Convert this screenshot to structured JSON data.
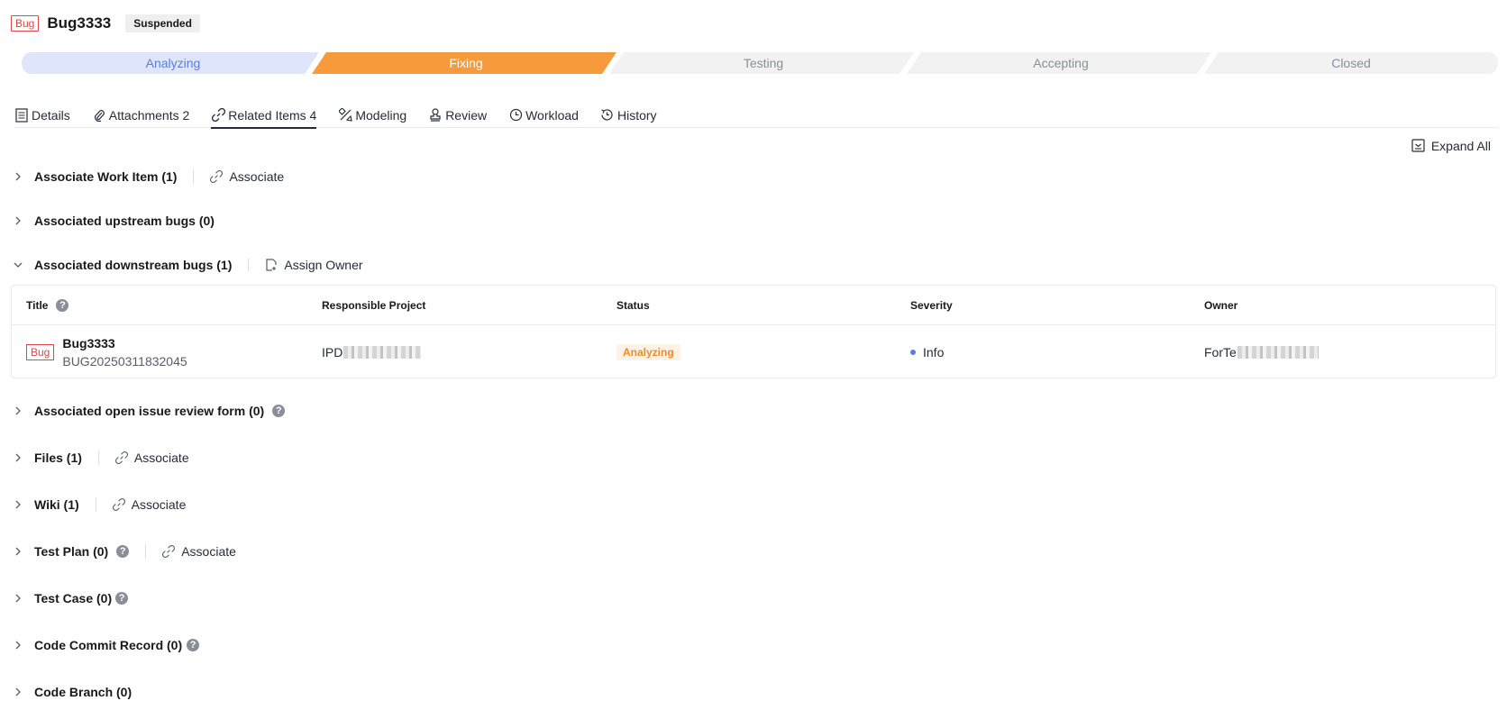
{
  "header": {
    "type_tag": "Bug",
    "title": "Bug3333",
    "state": "Suspended"
  },
  "stepper": {
    "steps": [
      "Analyzing",
      "Fixing",
      "Testing",
      "Accepting",
      "Closed"
    ],
    "current": "Fixing",
    "colors": {
      "done": "#dfe6fb",
      "done_text": "#5e7ce0",
      "current": "#f69a3c",
      "current_text": "#ffffff",
      "todo": "#f2f2f2",
      "todo_text": "#8a8e99"
    }
  },
  "tabs": [
    {
      "label": "Details",
      "icon": "document-list-icon"
    },
    {
      "label": "Attachments 2",
      "icon": "paperclip-icon"
    },
    {
      "label": "Related Items 4",
      "icon": "link-icon",
      "active": true
    },
    {
      "label": "Modeling",
      "icon": "modeling-icon"
    },
    {
      "label": "Review",
      "icon": "stamp-icon"
    },
    {
      "label": "Workload",
      "icon": "clock-icon"
    },
    {
      "label": "History",
      "icon": "history-icon"
    }
  ],
  "expand_all_label": "Expand All",
  "sections": {
    "work_item": {
      "title": "Associate Work Item (1)",
      "action": "Associate"
    },
    "upstream": {
      "title": "Associated upstream bugs (0)"
    },
    "downstream": {
      "title": "Associated downstream bugs (1)",
      "action": "Assign Owner"
    },
    "review_form": {
      "title": "Associated open issue review form (0)"
    },
    "files": {
      "title": "Files (1)",
      "action": "Associate"
    },
    "wiki": {
      "title": "Wiki (1)",
      "action": "Associate"
    },
    "test_plan": {
      "title": "Test Plan (0)",
      "action": "Associate"
    },
    "test_case": {
      "title": "Test Case (0)"
    },
    "commit": {
      "title": "Code Commit Record (0)"
    },
    "branch": {
      "title": "Code Branch (0)"
    }
  },
  "table": {
    "columns": [
      "Title",
      "Responsible Project",
      "Status",
      "Severity",
      "Owner"
    ],
    "rows": [
      {
        "tag": "Bug",
        "title": "Bug3333",
        "id": "BUG20250311832045",
        "project": "IPD",
        "status": "Analyzing",
        "severity": "Info",
        "owner": "ForTe"
      }
    ]
  },
  "help_glyph": "?"
}
